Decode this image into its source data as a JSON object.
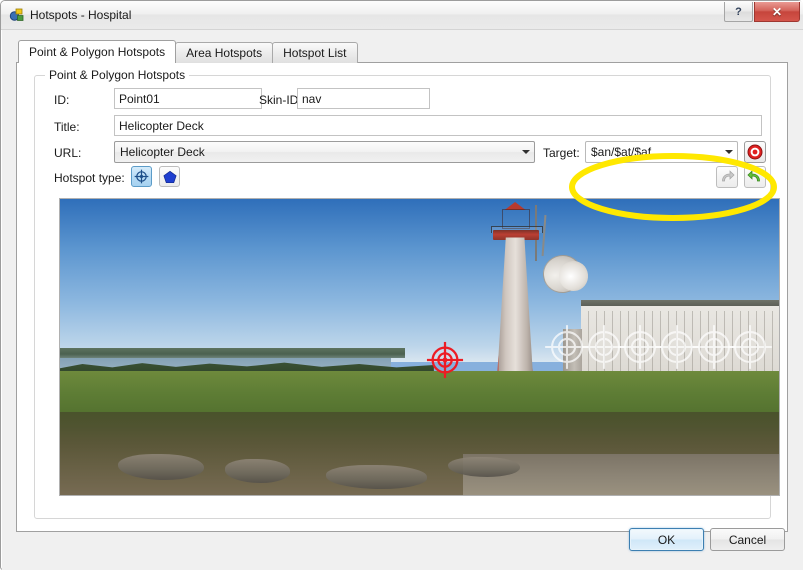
{
  "window": {
    "title": "Hotspots - Hospital",
    "icon": "app-hotspots-icon",
    "help_label": "?",
    "close_label": "✕"
  },
  "tabs": [
    {
      "label": "Point & Polygon Hotspots",
      "active": true
    },
    {
      "label": "Area Hotspots",
      "active": false
    },
    {
      "label": "Hotspot List",
      "active": false
    }
  ],
  "group": {
    "legend": "Point & Polygon Hotspots"
  },
  "fields": {
    "id_label": "ID:",
    "id_value": "Point01",
    "skin_id_label": "Skin-ID:",
    "skin_id_value": "nav",
    "title_label": "Title:",
    "title_value": "Helicopter Deck",
    "url_label": "URL:",
    "url_value": "Helicopter Deck",
    "target_label": "Target:",
    "target_value": "$an/$at/$af",
    "hotspot_type_label": "Hotspot type:"
  },
  "buttons": {
    "point_hotspot": "point-hotspot-tool",
    "polygon_hotspot": "polygon-hotspot-tool",
    "target_picker": "target-picker",
    "undo": "undo",
    "redo": "redo",
    "ok": "OK",
    "cancel": "Cancel"
  },
  "annotation": {
    "shape": "ellipse",
    "color": "#FFE800",
    "target": "target-combo-and-picker"
  },
  "preview": {
    "description": "Panorama preview: lighthouse with red and white stripes, white outbuilding, grass foreground, sea horizon",
    "selected_marker_color": "#ED1C24",
    "ghost_marker_color": "#FFFFFF",
    "markers": [
      {
        "x": 53.6,
        "y": 54.5,
        "state": "selected"
      },
      {
        "x": 70.5,
        "y": 50.0,
        "state": "ghost"
      },
      {
        "x": 75.6,
        "y": 50.0,
        "state": "ghost"
      },
      {
        "x": 80.7,
        "y": 50.0,
        "state": "ghost"
      },
      {
        "x": 85.8,
        "y": 50.0,
        "state": "ghost"
      },
      {
        "x": 90.9,
        "y": 50.0,
        "state": "ghost"
      },
      {
        "x": 96.0,
        "y": 50.0,
        "state": "ghost"
      }
    ]
  },
  "colors": {
    "accent": "#3C7FB1",
    "highlight": "#FFE800",
    "close_button": "#C6453C",
    "selected_tool": "#A6D1F0"
  }
}
